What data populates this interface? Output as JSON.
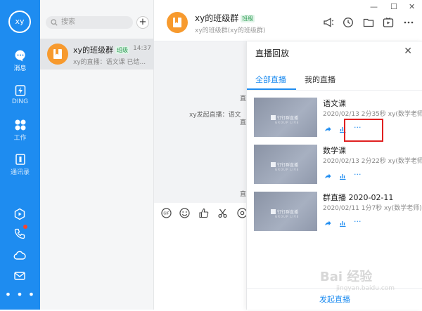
{
  "colors": {
    "accent": "#1E8CF0",
    "rail": "#1E8CF0",
    "group_avatar": "#f79a2e",
    "tag_green": "#2a9b51",
    "highlight": "#e02020"
  },
  "rail": {
    "avatar_text": "xy",
    "items": [
      {
        "label": "消息",
        "icon": "message-icon"
      },
      {
        "label": "DING",
        "icon": "ding-icon"
      },
      {
        "label": "工作",
        "icon": "workbench-icon"
      },
      {
        "label": "通讯录",
        "icon": "contacts-icon"
      }
    ],
    "more": "• • •"
  },
  "list": {
    "search_placeholder": "搜索",
    "add_label": "+",
    "conversation": {
      "title": "xy的班级群",
      "tag": "班级",
      "time": "14:37",
      "preview": "xy的直播：语文课 已结..."
    }
  },
  "window_controls": {
    "minimize": "—",
    "maximize": "☐",
    "close": "✕"
  },
  "chat": {
    "title": "xy的班级群",
    "tag": "班级",
    "subtitle": "xy的班级群(xy的班级群)",
    "messages": [
      "直",
      "xy发起直播：语文",
      "直"
    ],
    "footer_messages": [
      "直"
    ]
  },
  "drawer": {
    "title": "直播回放",
    "close": "✕",
    "tabs": [
      "全部直播",
      "我的直播"
    ],
    "thumb_logo": "钉钉群直播",
    "thumb_sub": "GROUP LIVE",
    "records": [
      {
        "title": "语文课",
        "meta": "2020/02/13 2分35秒 xy(数学老师)"
      },
      {
        "title": "数学课",
        "meta": "2020/02/13 2分22秒 xy(数学老师)"
      },
      {
        "title": "群直播 2020-02-11",
        "meta": "2020/02/11 1分7秒 xy(数学老师)"
      }
    ],
    "more_label": "···",
    "footer_button": "发起直播"
  },
  "watermark": {
    "main": "Bai 经验",
    "sub": "jingyan.baidu.com"
  }
}
